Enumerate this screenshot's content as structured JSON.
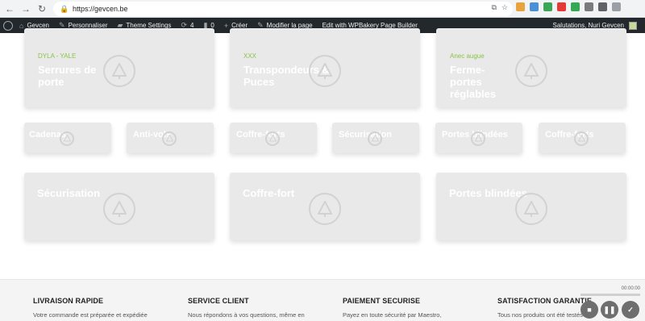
{
  "browser": {
    "url": "https://gevcen.be",
    "extension_colors": [
      "#e8a33d",
      "#4a90d9",
      "#3aa757",
      "#e53935",
      "#34a853",
      "#7b7b7b",
      "#5f6368",
      "#9aa0a6"
    ]
  },
  "wp_admin": {
    "site_name": "Gevcen",
    "customize": "Personnaliser",
    "theme_settings": "Theme Settings",
    "updates_count": "4",
    "comments_count": "0",
    "new_label": "Créer",
    "edit_page": "Modifier la page",
    "wpbakery": "Edit with WPBakery Page Builder",
    "greeting": "Salutations, Nuri Gevcen"
  },
  "cards_large_top": [
    {
      "tag": "DYLA - YALE",
      "title": "Serrures de porte"
    },
    {
      "tag": "XXX",
      "title": "Transpondeurs & Puces"
    },
    {
      "tag": "Anec augue",
      "title": "Ferme-portes réglables"
    }
  ],
  "cards_small": [
    {
      "title": "Cadenas"
    },
    {
      "title": "Anti-vols"
    },
    {
      "title": "Coffre-forts"
    },
    {
      "title": "Sécurisation"
    },
    {
      "title": "Portes blindées"
    },
    {
      "title": "Coffre-forts"
    }
  ],
  "cards_large_bottom": [
    {
      "title": "Sécurisation"
    },
    {
      "title": "Coffre-fort"
    },
    {
      "title": "Portes blindées"
    }
  ],
  "footer": {
    "columns": [
      {
        "heading": "LIVRAISON RAPIDE",
        "text": "Votre commande est préparée et expédiée"
      },
      {
        "heading": "SERVICE CLIENT",
        "text": "Nous répondons à vos questions, même en"
      },
      {
        "heading": "PAIEMENT SECURISE",
        "text": "Payez en toute sécurité par Maestro,"
      },
      {
        "heading": "SATISFACTION GARANTIE",
        "text": "Tous nos produits ont été testés et"
      }
    ]
  },
  "video": {
    "time": "00:00:00"
  }
}
